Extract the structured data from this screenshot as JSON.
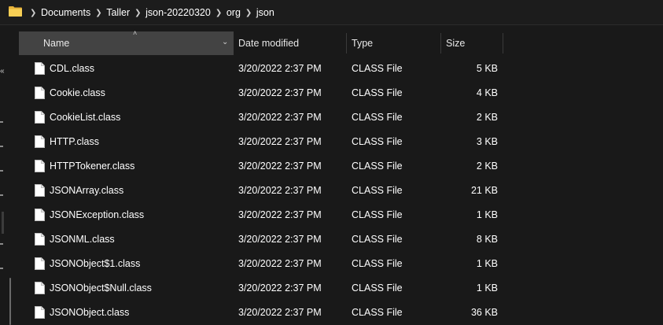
{
  "address_bar": {
    "breadcrumbs": [
      "Documents",
      "Taller",
      "json-20220320",
      "org",
      "json"
    ]
  },
  "columns": {
    "name": "Name",
    "date_modified": "Date modified",
    "type": "Type",
    "size": "Size"
  },
  "files": [
    {
      "name": "CDL.class",
      "date": "3/20/2022 2:37 PM",
      "type": "CLASS File",
      "size": "5 KB"
    },
    {
      "name": "Cookie.class",
      "date": "3/20/2022 2:37 PM",
      "type": "CLASS File",
      "size": "4 KB"
    },
    {
      "name": "CookieList.class",
      "date": "3/20/2022 2:37 PM",
      "type": "CLASS File",
      "size": "2 KB"
    },
    {
      "name": "HTTP.class",
      "date": "3/20/2022 2:37 PM",
      "type": "CLASS File",
      "size": "3 KB"
    },
    {
      "name": "HTTPTokener.class",
      "date": "3/20/2022 2:37 PM",
      "type": "CLASS File",
      "size": "2 KB"
    },
    {
      "name": "JSONArray.class",
      "date": "3/20/2022 2:37 PM",
      "type": "CLASS File",
      "size": "21 KB"
    },
    {
      "name": "JSONException.class",
      "date": "3/20/2022 2:37 PM",
      "type": "CLASS File",
      "size": "1 KB"
    },
    {
      "name": "JSONML.class",
      "date": "3/20/2022 2:37 PM",
      "type": "CLASS File",
      "size": "8 KB"
    },
    {
      "name": "JSONObject$1.class",
      "date": "3/20/2022 2:37 PM",
      "type": "CLASS File",
      "size": "1 KB"
    },
    {
      "name": "JSONObject$Null.class",
      "date": "3/20/2022 2:37 PM",
      "type": "CLASS File",
      "size": "1 KB"
    },
    {
      "name": "JSONObject.class",
      "date": "3/20/2022 2:37 PM",
      "type": "CLASS File",
      "size": "36 KB"
    }
  ],
  "colors": {
    "background": "#191919",
    "header_active": "#434343",
    "folder": "#f4c84a",
    "text": "#ffffff"
  }
}
